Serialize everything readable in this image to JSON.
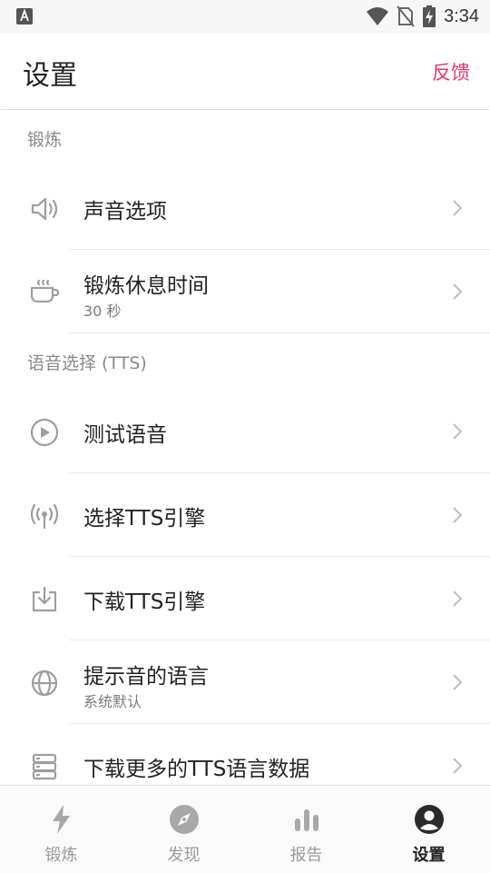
{
  "status_bar": {
    "time": "3:34"
  },
  "app_bar": {
    "title": "设置",
    "feedback_label": "反馈"
  },
  "sections": [
    {
      "header": "锻炼",
      "items": [
        {
          "title": "声音选项",
          "subtitle": "",
          "icon": "speaker-icon"
        },
        {
          "title": "锻炼休息时间",
          "subtitle": "30 秒",
          "icon": "coffee-cup-icon"
        }
      ]
    },
    {
      "header": "语音选择 (TTS)",
      "items": [
        {
          "title": "测试语音",
          "subtitle": "",
          "icon": "play-circle-icon"
        },
        {
          "title": "选择TTS引擎",
          "subtitle": "",
          "icon": "broadcast-icon"
        },
        {
          "title": "下载TTS引擎",
          "subtitle": "",
          "icon": "download-tray-icon"
        },
        {
          "title": "提示音的语言",
          "subtitle": "系统默认",
          "icon": "globe-icon"
        },
        {
          "title": "下载更多的TTS语言数据",
          "subtitle": "",
          "icon": "database-icon"
        }
      ]
    }
  ],
  "bottom_nav": [
    {
      "label": "锻炼",
      "icon": "lightning-icon",
      "active": false
    },
    {
      "label": "发现",
      "icon": "compass-icon",
      "active": false
    },
    {
      "label": "报告",
      "icon": "bar-chart-icon",
      "active": false
    },
    {
      "label": "设置",
      "icon": "profile-icon",
      "active": true
    }
  ],
  "colors": {
    "accent": "#e8336a",
    "icon_gray": "#9e9e9e",
    "active_nav": "#222222"
  }
}
